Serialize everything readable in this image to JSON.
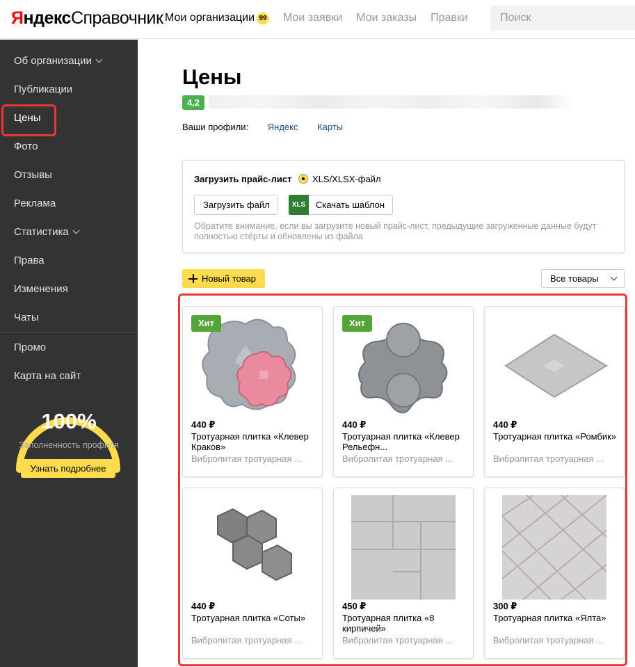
{
  "header": {
    "logo_red": "Я",
    "logo_black": "ндекс",
    "logo_sub": "Справочник",
    "nav": [
      {
        "label": "Мои организации",
        "badge": "99"
      },
      {
        "label": "Мои заявки"
      },
      {
        "label": "Мои заказы"
      },
      {
        "label": "Правки"
      }
    ],
    "search_placeholder": "Поиск"
  },
  "sidebar": {
    "items": [
      {
        "label": "Об организации",
        "has_chevron": true
      },
      {
        "label": "Публикации"
      },
      {
        "label": "Цены",
        "active": true
      },
      {
        "label": "Фото"
      },
      {
        "label": "Отзывы"
      },
      {
        "label": "Реклама"
      },
      {
        "label": "Статистика",
        "has_chevron": true
      },
      {
        "label": "Права"
      },
      {
        "label": "Изменения"
      },
      {
        "label": "Чаты"
      },
      {
        "label": "Промо"
      },
      {
        "label": "Карта на сайт"
      }
    ],
    "profile_fill": {
      "value": "100%",
      "fraction": 1.0,
      "label": "Заполненность профиля",
      "button": "Узнать подробнее"
    }
  },
  "main": {
    "title": "Цены",
    "rating": "4,2",
    "profiles_label": "Ваши профили:",
    "profile_links": [
      "Яндекс",
      "Карты"
    ],
    "upload": {
      "label": "Загрузить прайс-лист",
      "format_option": "XLS/XLSX-файл",
      "upload_button": "Загрузить файл",
      "template_icon": "XLS",
      "template_button": "Скачать шаблон",
      "note": "Обратите внимание, если вы загрузите новый прайс-лист, предыдущие загруженные данные будут полностью стёрты и обновлены из файла"
    },
    "new_item_button": "Новый товар",
    "filter_value": "Все товары",
    "products": [
      {
        "badge": "Хит",
        "price": "440 ₽",
        "title": "Тротуарная плитка «Клевер Краков»",
        "desc": "Вибролитая тротуарная ...",
        "image": "clover-tile"
      },
      {
        "badge": "Хит",
        "price": "440 ₽",
        "title": "Тротуарная плитка «Клевер Рельефн...",
        "desc": "Вибролитая тротуарная ...",
        "image": "clover-relief-tile"
      },
      {
        "badge": "",
        "price": "440 ₽",
        "title": "Тротуарная плитка «Ромбик»",
        "desc": "Вибролитая тротуарная ...",
        "image": "rhombus-tile"
      },
      {
        "badge": "",
        "price": "440 ₽",
        "title": "Тротуарная плитка «Соты»",
        "desc": "Вибролитая тротуарная ...",
        "image": "honeycomb-tile"
      },
      {
        "badge": "",
        "price": "450 ₽",
        "title": "Тротуарная плитка «8 кирпичей»",
        "desc": "Вибролитая тротуарная ...",
        "image": "brick-tile"
      },
      {
        "badge": "",
        "price": "300 ₽",
        "title": "Тротуарная плитка «Ялта»",
        "desc": "Вибролитая тротуарная ...",
        "image": "yalta-tile"
      }
    ]
  },
  "colors": {
    "accent_yellow": "#ffdb4d",
    "sidebar_bg": "#333333",
    "highlight_red": "#e53935",
    "hit_green": "#52a536",
    "rating_green": "#4caf50"
  }
}
